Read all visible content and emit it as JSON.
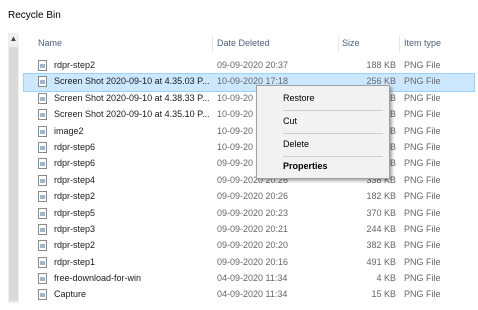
{
  "window": {
    "title": "Recycle Bin"
  },
  "columns": {
    "name": "Name",
    "date": "Date Deleted",
    "size": "Size",
    "type": "Item type"
  },
  "files": [
    {
      "name": "rdpr-step2",
      "date": "09-09-2020 20:37",
      "size": "188 KB",
      "type": "PNG File"
    },
    {
      "name": "Screen Shot 2020-09-10 at 4.35.03 P...",
      "date": "10-09-2020 17:18",
      "size": "256 KB",
      "type": "PNG File"
    },
    {
      "name": "Screen Shot 2020-09-10 at 4.38.33 P...",
      "date": "10-09-20",
      "size": "KB",
      "type": "PNG File"
    },
    {
      "name": "Screen Shot 2020-09-10 at 4.35.10 P...",
      "date": "10-09-20",
      "size": "KB",
      "type": "PNG File"
    },
    {
      "name": "image2",
      "date": "10-09-20",
      "size": "KB",
      "type": "PNG File"
    },
    {
      "name": "rdpr-step6",
      "date": "10-09-20",
      "size": "KB",
      "type": "PNG File"
    },
    {
      "name": "rdpr-step6",
      "date": "09-09-20",
      "size": "KB",
      "type": "PNG File"
    },
    {
      "name": "rdpr-step4",
      "date": "09-09-2020 20:26",
      "size": "338 KB",
      "type": "PNG File"
    },
    {
      "name": "rdpr-step2",
      "date": "09-09-2020 20:26",
      "size": "182 KB",
      "type": "PNG File"
    },
    {
      "name": "rdpr-step5",
      "date": "09-09-2020 20:23",
      "size": "370 KB",
      "type": "PNG File"
    },
    {
      "name": "rdpr-step3",
      "date": "09-09-2020 20:21",
      "size": "244 KB",
      "type": "PNG File"
    },
    {
      "name": "rdpr-step2",
      "date": "09-09-2020 20:20",
      "size": "382 KB",
      "type": "PNG File"
    },
    {
      "name": "rdpr-step1",
      "date": "09-09-2020 20:16",
      "size": "491 KB",
      "type": "PNG File"
    },
    {
      "name": "free-download-for-win",
      "date": "04-09-2020 11:34",
      "size": "4 KB",
      "type": "PNG File"
    },
    {
      "name": "Capture",
      "date": "04-09-2020 11:34",
      "size": "15 KB",
      "type": "PNG File"
    }
  ],
  "context_menu": {
    "restore": "Restore",
    "cut": "Cut",
    "delete": "Delete",
    "properties": "Properties"
  },
  "icons": {
    "scroll_up": "▲",
    "file_icon": "png-file-icon"
  },
  "colors": {
    "selection": "#cce8ff",
    "header_text": "#4c607a"
  }
}
